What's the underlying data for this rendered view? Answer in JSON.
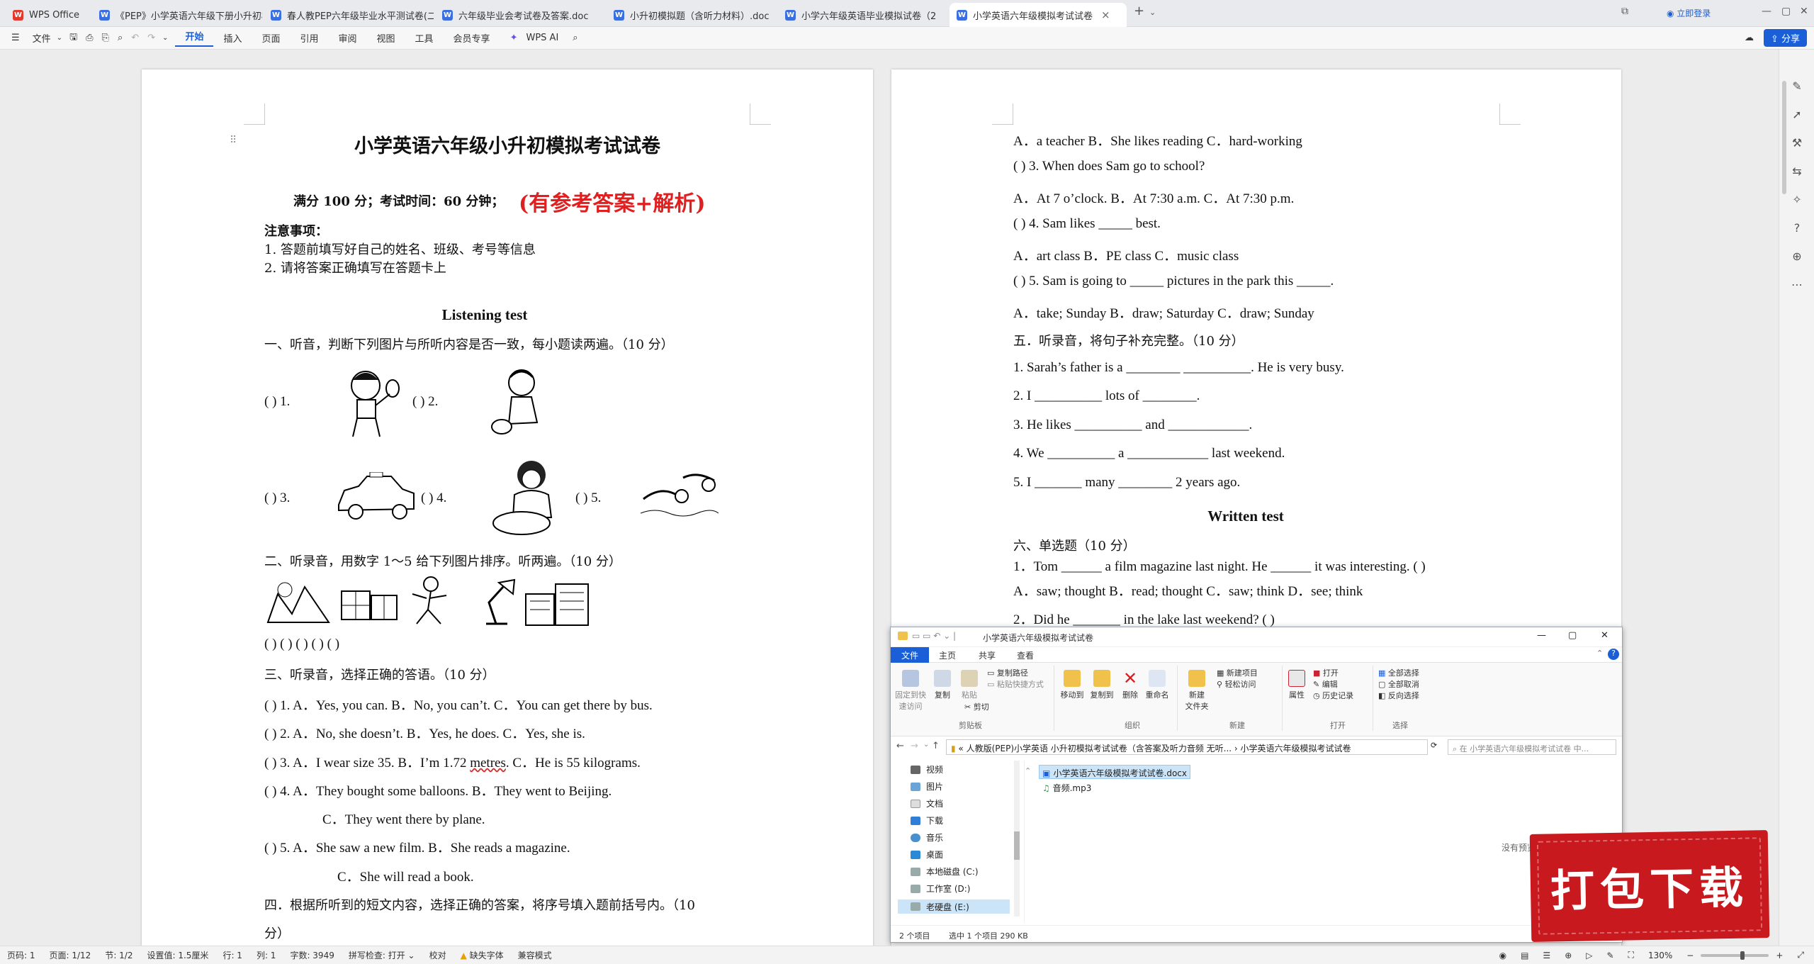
{
  "tabs": [
    {
      "label": "WPS Office",
      "icon": "wps-logo-icon"
    },
    {
      "label": "《PEP》小学英语六年级下册小升初模"
    },
    {
      "label": "春人教PEP六年级毕业水平测试卷(二)"
    },
    {
      "label": "六年级毕业会考试卷及答案.doc"
    },
    {
      "label": "小升初模拟题（含听力材料）.doc"
    },
    {
      "label": "小学六年级英语毕业模拟试卷（2"
    },
    {
      "label": "小学英语六年级模拟考试试卷"
    }
  ],
  "titlebar": {
    "login_label": "立即登录"
  },
  "ribbon": {
    "file_label": "文件",
    "tabs": [
      "开始",
      "插入",
      "页面",
      "引用",
      "审阅",
      "视图",
      "工具",
      "会员专享"
    ],
    "wps_ai_label": "WPS AI",
    "share_label": "分享"
  },
  "page1": {
    "title": "小学英语六年级小升初模拟考试试卷",
    "subtitle": "满分 100 分；考试时间：60 分钟；",
    "red_note": "(有参考答案+解析)",
    "notice_head": "注意事项：",
    "notice_1": "1.  答题前填写好自己的姓名、班级、考号等信息",
    "notice_2": "2.  请将答案正确填写在答题卡上",
    "listening_head": "Listening test",
    "sec1": "一、听音，判断下列图片与所听内容是否一致，每小题读两遍。（10 分）",
    "q1": "(         ) 1.",
    "q2": "(         ) 2.",
    "q3": "(         ) 3.",
    "q4": "(         ) 4.",
    "q5": "(         ) 5.",
    "sec2": "二、听录音，用数字 1～5 给下列图片排序。听两遍。（10 分）",
    "sec2_blanks": "(         )          (         )     (         )       (         )       (         )",
    "sec3": "三、听录音，选择正确的答语。（10 分）",
    "s3_1": "(           ) 1. A．Yes, you can.    B．No, you can’t.     C．You can get there by bus.",
    "s3_2": "(           ) 2. A．No, she doesn’t.     B．Yes, he does.     C．Yes, she is.",
    "s3_3a": "(           ) 3. A．I wear size 35.      B．I’m 1.72 ",
    "s3_3b": "metres",
    "s3_3c": ".     C．He is 55 kilograms.",
    "s3_4": "(           ) 4. A．They bought some balloons.    B．They went to Beijing.",
    "s3_4c": "C．They went there by plane.",
    "s3_5": "(           ) 5. A．She saw a new film.    B．She reads a magazine.",
    "s3_5c": "C．She will read a book.",
    "sec4": "四．根据所听到的短文内容，选择正确的答案，将序号填入题前括号内。（10",
    "sec4b": "分）"
  },
  "page2": {
    "l1": "A．a teacher    B．She likes reading    C．hard-working",
    "l2": "(          ) 3. When does Sam go to school?",
    "l3": "A．At 7 o’clock.    B．At 7:30 a.m.    C．At 7:30 p.m.",
    "l4": "(          ) 4. Sam likes _____ best.",
    "l5": "A．art class    B．PE class    C．music class",
    "l6": "(          ) 5. Sam is going to _____ pictures in the park this _____.",
    "l7": "A．take; Sunday    B．draw; Saturday    C．draw; Sunday",
    "l8": "五．听录音，将句子补充完整。（10 分）",
    "l9": "1. Sarah’s father is a ________ __________. He is very busy.",
    "l10": "2. I __________ lots of ________.",
    "l11": "3. He likes __________ and ____________.",
    "l12": "4. We __________ a ____________ last weekend.",
    "l13": "5. I _______ many ________ 2 years ago.",
    "written_head": "Written test",
    "l14": "六、单选题（10 分）",
    "l15": "1．Tom ______ a film magazine last night. He ______ it was interesting. (   )",
    "l16": "A．saw; thought      B．read; thought     C．saw; think         D．see; think",
    "l17": "2．Did he _______ in the lake last weekend? (   )"
  },
  "status": {
    "page_num": "页码: 1",
    "pages": "页面: 1/12",
    "section": "节: 1/2",
    "setting": "设置值: 1.5厘米",
    "row": "行: 1",
    "col": "列: 1",
    "words": "字数: 3949",
    "spell": "拼写检查: 打开",
    "proof": "校对",
    "missing_font": "缺失字体",
    "compat": "兼容模式",
    "zoom": "130%"
  },
  "explorer": {
    "title": "小学英语六年级模拟考试试卷",
    "tabs": [
      "文件",
      "主页",
      "共享",
      "查看"
    ],
    "btn_pin": "固定到快\n速访问",
    "btn_copy": "复制",
    "btn_paste": "粘贴",
    "btn_copypath": "复制路径",
    "btn_pasteshortcut": "粘贴快捷方式",
    "btn_cut": "剪切",
    "grp_clipboard": "剪贴板",
    "btn_moveto": "移动到",
    "btn_copyto": "复制到",
    "btn_delete": "删除",
    "btn_rename": "重命名",
    "grp_organize": "组织",
    "btn_newfolder": "新建\n文件夹",
    "btn_newitem": "新建项目",
    "btn_easyaccess": "轻松访问",
    "grp_new": "新建",
    "btn_props": "属性",
    "btn_open": "打开",
    "btn_edit": "编辑",
    "btn_history": "历史记录",
    "grp_open": "打开",
    "btn_selectall": "全部选择",
    "btn_selectnone": "全部取消",
    "btn_invert": "反向选择",
    "grp_select": "选择",
    "path": "«  人教版(PEP)小学英语 小升初模拟考试试卷（含答案及听力音频 无听...  ›  小学英语六年级模拟考试试卷",
    "search_placeholder": "在 小学英语六年级模拟考试试卷 中...",
    "nav": [
      "视频",
      "图片",
      "文档",
      "下载",
      "音乐",
      "桌面",
      "本地磁盘 (C:)",
      "工作室 (D:)",
      "老硬盘 (E:)"
    ],
    "files": [
      "小学英语六年级模拟考试试卷.docx",
      "音频.mp3"
    ],
    "no_preview": "没有预览。",
    "status_items": "2 个项目",
    "status_selected": "选中 1 个项目  290 KB"
  },
  "banner": {
    "text": "打包下载"
  }
}
